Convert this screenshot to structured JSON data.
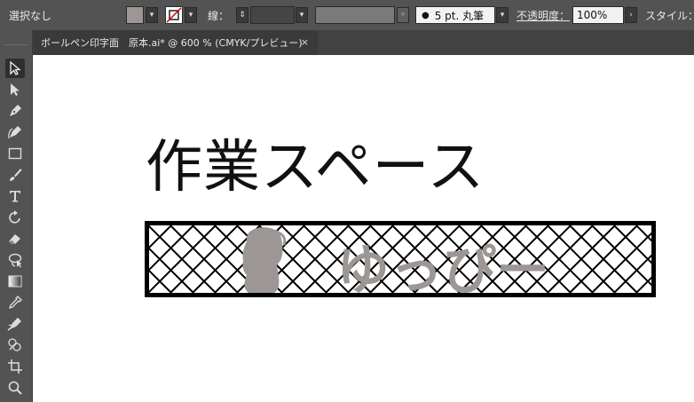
{
  "control_bar": {
    "selection_label": "選択なし",
    "stroke_label": "線：",
    "brush_label": "5 pt. 丸筆",
    "opacity_label": "不透明度：",
    "opacity_value": "100%",
    "style_label": "スタイル："
  },
  "document_tab": {
    "title": "ボールペン印字面　原本.ai* @ 600 % (CMYK/プレビュー)",
    "close_glyph": "×"
  },
  "artwork": {
    "heading_text": "作業スペース",
    "stamp_text": "ゆっぴー"
  },
  "tools": [
    "selection-tool",
    "direct-selection-tool",
    "pen-tool",
    "curvature-tool",
    "rectangle-tool",
    "paintbrush-tool",
    "type-tool",
    "rotate-tool",
    "eraser-tool",
    "lasso-tool",
    "gradient-tool",
    "eyedropper-tool",
    "blend-tool",
    "shape-builder-tool",
    "artboard-tool",
    "zoom-tool"
  ],
  "colors": {
    "ui_bg": "#535353",
    "fill_swatch": "#9c9794",
    "stamp_gray": "#9c9794",
    "none_red": "#d00000"
  }
}
